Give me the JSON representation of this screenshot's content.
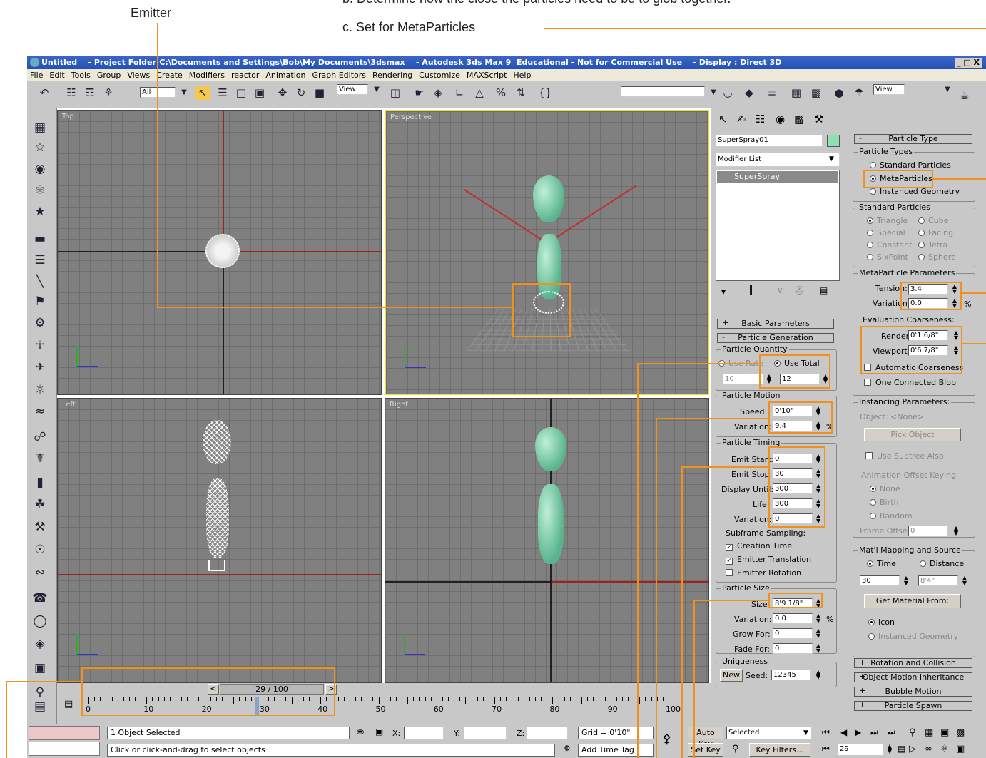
{
  "annotations": {
    "emitter": "Emitter",
    "step_b": "b. Determine how the close the particles need to be to glob together.",
    "step_c": "c. Set for MetaParticles"
  },
  "window": {
    "title": "Untitled    - Project Folder:C:\\Documents and Settings\\Bob\\My Documents\\3dsmax    - Autodesk 3ds Max 9  Educational - Not for Commercial Use    - Display : Direct 3D",
    "controls": "_ □ X"
  },
  "menu": [
    "File",
    "Edit",
    "Tools",
    "Group",
    "Views",
    "Create",
    "Modifiers",
    "reactor",
    "Animation",
    "Graph Editors",
    "Rendering",
    "Customize",
    "MAXScript",
    "Help"
  ],
  "toolbar": {
    "selection_filter": "All",
    "ref_coord": "View",
    "ref_coord2": "View"
  },
  "viewports": {
    "top": "Top",
    "perspective": "Perspective",
    "left": "Left",
    "right": "Right"
  },
  "command_panel": {
    "object_name": "SuperSpray01",
    "modifier_list": "Modifier List",
    "stack_item": "SuperSpray",
    "rollouts_left": {
      "basic": "Basic Parameters",
      "generation": "Particle Generation"
    },
    "quantity": {
      "title": "Particle Quantity",
      "use_rate": "Use Rate",
      "use_total": "Use Total",
      "rate_val": "10",
      "total_val": "12"
    },
    "motion": {
      "title": "Particle Motion",
      "speed_label": "Speed:",
      "speed": "0'10\"",
      "var_label": "Variation:",
      "var": "9.4",
      "pct": "%"
    },
    "timing": {
      "title": "Particle Timing",
      "emit_start_label": "Emit Start:",
      "emit_start": "0",
      "emit_stop_label": "Emit Stop:",
      "emit_stop": "30",
      "display_until_label": "Display Until:",
      "display_until": "300",
      "life_label": "Life:",
      "life": "300",
      "variation_label": "Variation:",
      "variation": "0",
      "subframe": "Subframe Sampling:",
      "creation_time": "Creation Time",
      "emitter_translation": "Emitter Translation",
      "emitter_rotation": "Emitter Rotation"
    },
    "size": {
      "title": "Particle Size",
      "size_label": "Size:",
      "size": "8'9 1/8\"",
      "var_label": "Variation:",
      "var": "0.0",
      "grow_label": "Grow For:",
      "grow": "0",
      "fade_label": "Fade For:",
      "fade": "0",
      "pct": "%"
    },
    "uniqueness": {
      "title": "Uniqueness",
      "new_btn": "New",
      "seed_label": "Seed:",
      "seed": "12345"
    },
    "particle_type": {
      "rollout": "Particle Type",
      "types_title": "Particle Types",
      "standard": "Standard Particles",
      "meta": "MetaParticles",
      "instanced": "Instanced Geometry",
      "std_title": "Standard Particles",
      "triangle": "Triangle",
      "cube": "Cube",
      "special": "Special",
      "facing": "Facing",
      "constant": "Constant",
      "tetra": "Tetra",
      "sixpoint": "SixPoint",
      "sphere": "Sphere",
      "meta_title": "MetaParticle Parameters",
      "tension_label": "Tension:",
      "tension": "3.4",
      "variation_label": "Variation:",
      "variation": "0.0",
      "pct": "%",
      "coarse_title": "Evaluation Coarseness:",
      "render_label": "Render:",
      "render": "0'1 6/8\"",
      "viewport_label": "Viewport:",
      "viewport": "0'6 7/8\"",
      "auto_coarse": "Automatic Coarseness",
      "one_blob": "One Connected Blob",
      "inst_title": "Instancing Parameters:",
      "object_none": "Object: <None>",
      "pick_object": "Pick Object",
      "use_subtree": "Use Subtree Also",
      "anim_offset": "Animation Offset Keying",
      "none": "None",
      "birth": "Birth",
      "random": "Random",
      "frame_offset_label": "Frame Offset:",
      "frame_offset": "0",
      "mat_title": "Mat'l Mapping and Source",
      "time": "Time",
      "distance": "Distance",
      "time_val": "30",
      "dist_val": "8'4\"",
      "get_material": "Get Material From:",
      "icon": "Icon",
      "instanced_geom": "Instanced Geometry"
    },
    "rollouts_right": [
      "Rotation and Collision",
      "Object Motion Inheritance",
      "Bubble Motion",
      "Particle Spawn"
    ]
  },
  "timeline": {
    "slider": "29 / 100",
    "ticks": [
      "0",
      "10",
      "20",
      "30",
      "40",
      "50",
      "60",
      "70",
      "80",
      "90",
      "100"
    ]
  },
  "status": {
    "selected": "1 Object Selected",
    "prompt": "Click or click-and-drag to select objects",
    "x_label": "X:",
    "y_label": "Y:",
    "z_label": "Z:",
    "grid": "Grid = 0'10\"",
    "add_time_tag": "Add Time Tag",
    "auto_key": "Auto Key",
    "set_key": "Set Key",
    "key_mode": "Selected",
    "key_filters": "Key Filters...",
    "frame": "29"
  }
}
